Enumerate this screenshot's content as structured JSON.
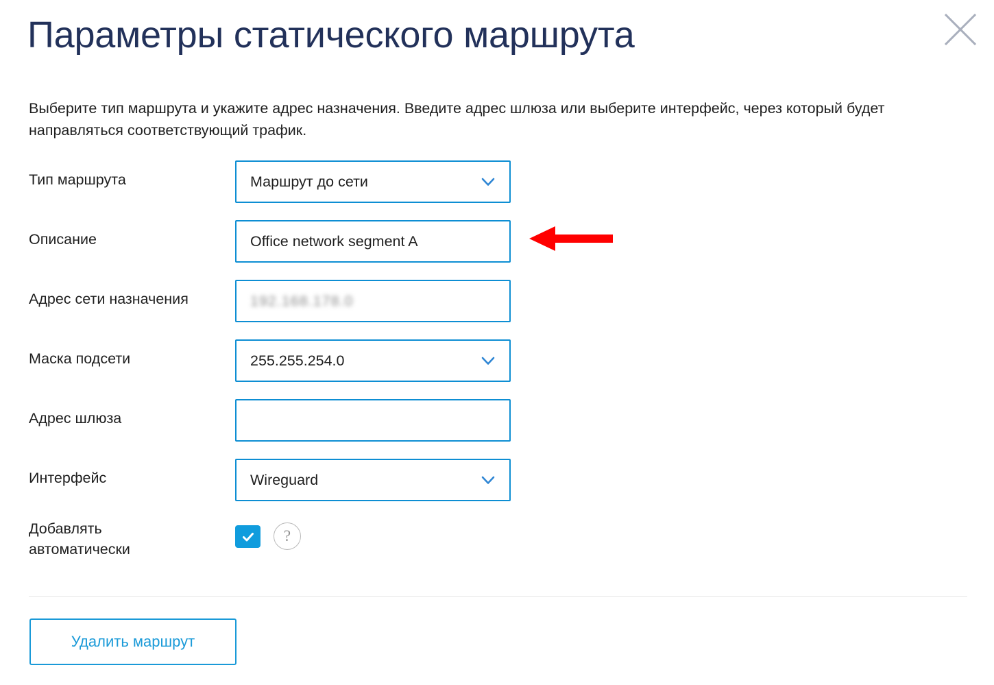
{
  "dialog": {
    "title": "Параметры статического маршрута",
    "close_label": "close-icon",
    "intro": "Выберите тип маршрута и укажите адрес назначения. Введите адрес шлюза или выберите интерфейс, через который будет направляться соответствующий трафик.",
    "accent_color": "#0d8ed3",
    "title_color": "#22315a",
    "checkbox_color": "#109cdd",
    "annotation_color": "#ff0000"
  },
  "fields": {
    "route_type": {
      "label": "Тип маршрута",
      "value": "Маршрут до сети",
      "control": "select",
      "icon": "chevron-down-icon"
    },
    "description": {
      "label": "Описание",
      "value": "Office network segment A",
      "placeholder": "",
      "control": "text"
    },
    "destination_network": {
      "label": "Адрес сети назначения",
      "value": "192.168.178.0",
      "redacted": true,
      "control": "text"
    },
    "subnet_mask": {
      "label": "Маска подсети",
      "value": "255.255.254.0",
      "control": "select",
      "icon": "chevron-down-icon"
    },
    "gateway_address": {
      "label": "Адрес шлюза",
      "value": "",
      "placeholder": "",
      "control": "text"
    },
    "interface": {
      "label": "Интерфейс",
      "value": "Wireguard",
      "control": "select",
      "icon": "chevron-down-icon"
    },
    "add_automatically": {
      "label_line1": "Добавлять",
      "label_line2": "автоматически",
      "checked": true,
      "control": "checkbox",
      "help_glyph": "?"
    }
  },
  "footer": {
    "delete_label": "Удалить маршрут"
  },
  "annotation": {
    "type": "arrow",
    "direction": "left",
    "points_at": "description"
  }
}
